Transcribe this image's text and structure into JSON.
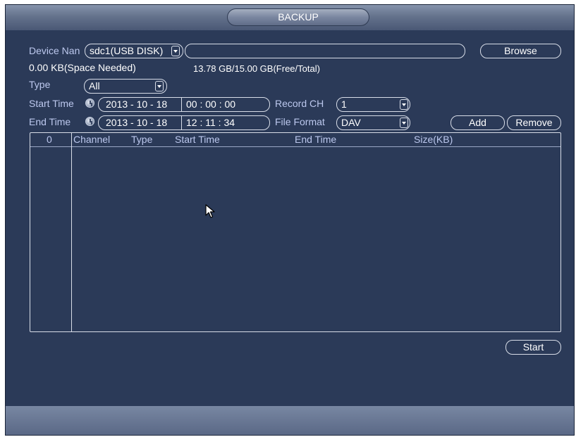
{
  "window": {
    "title": "BACKUP"
  },
  "device": {
    "label": "Device Nan",
    "selected": "sdc1(USB DISK)",
    "path_value": "",
    "browse_label": "Browse"
  },
  "space": {
    "needed": "0.00 KB(Space Needed)",
    "free_total": "13.78 GB/15.00 GB(Free/Total)"
  },
  "type": {
    "label": "Type",
    "selected": "All"
  },
  "start_time": {
    "label": "Start Time",
    "date": "2013 - 10 - 18",
    "time": "00 : 00 : 00"
  },
  "end_time": {
    "label": "End Time",
    "date": "2013 - 10 - 18",
    "time": "12 : 11 : 34"
  },
  "record_ch": {
    "label": "Record CH",
    "selected": "1"
  },
  "file_format": {
    "label": "File Format",
    "selected": "DAV"
  },
  "actions": {
    "add_label": "Add",
    "remove_label": "Remove",
    "start_label": "Start"
  },
  "file_list": {
    "count": "0",
    "columns": [
      "Channel",
      "Type",
      "Start Time",
      "End Time",
      "Size(KB)"
    ],
    "rows": []
  },
  "icons": [
    "clock-icon",
    "chevron-down-icon",
    "mouse-cursor-icon"
  ],
  "colors": {
    "background": "#2b3a58",
    "label": "#bcc8ee",
    "border": "#d8dde8"
  }
}
